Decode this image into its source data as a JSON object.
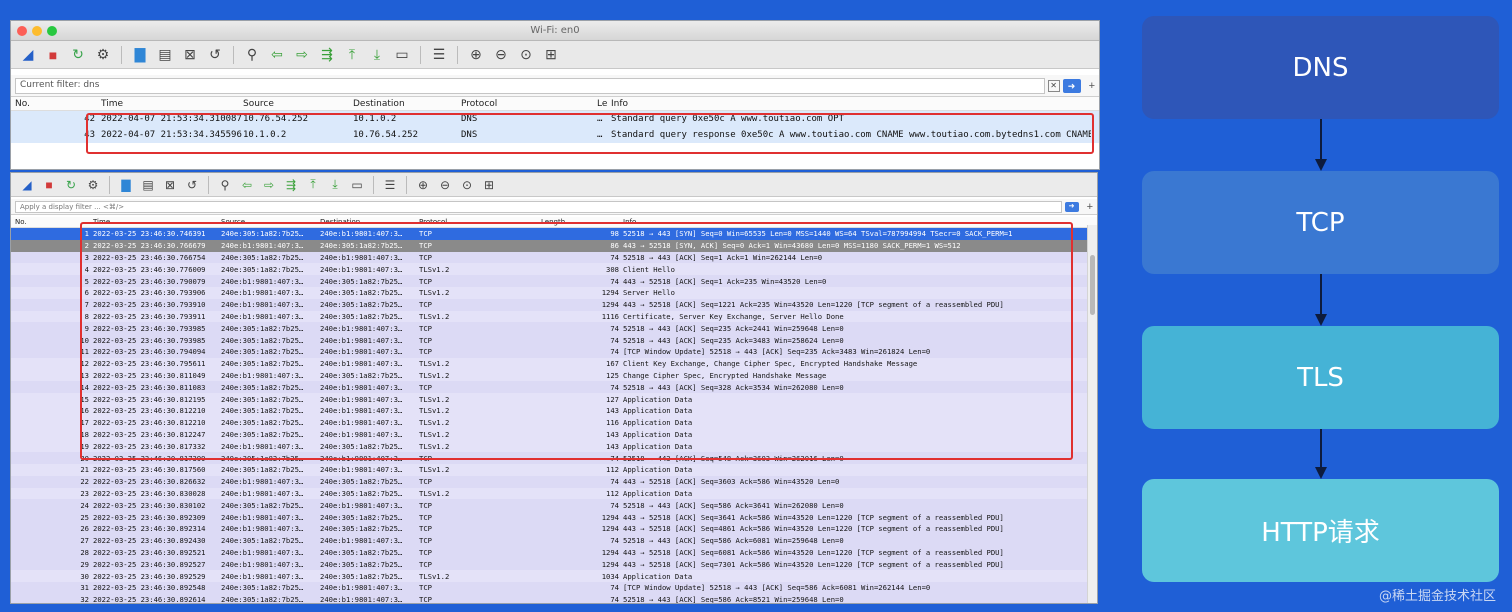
{
  "window1": {
    "title": "Wi-Fi: en0",
    "filter_value": "Current filter: dns",
    "columns": [
      "No.",
      "Time",
      "Source",
      "Destination",
      "Protocol",
      "Le",
      "Info"
    ],
    "rows": [
      {
        "no": "42",
        "time": "2022-04-07 21:53:34.310087",
        "src": "10.76.54.252",
        "dst": "10.1.0.2",
        "proto": "DNS",
        "len": "…",
        "info": "Standard query 0xe50c A www.toutiao.com OPT"
      },
      {
        "no": "43",
        "time": "2022-04-07 21:53:34.345596",
        "src": "10.1.0.2",
        "dst": "10.76.54.252",
        "proto": "DNS",
        "len": "…",
        "info": "Standard query response 0xe50c A www.toutiao.com CNAME www.toutiao.com.bytedns1.com CNAME www.t"
      }
    ]
  },
  "window2": {
    "filter_placeholder": "Apply a display filter ... <⌘/>",
    "columns": [
      "No.",
      "Time",
      "Source",
      "Destination",
      "Protocol",
      "Length",
      "Info"
    ],
    "rows": [
      {
        "no": "1",
        "time": "2022-03-25 23:46:30.746391",
        "src": "240e:305:1a82:7b25…",
        "dst": "240e:b1:9801:407:3…",
        "proto": "TCP",
        "len": "98",
        "info": "52518 → 443 [SYN] Seq=0 Win=65535 Len=0 MSS=1440 WS=64 TSval=787994994 TSecr=0 SACK_PERM=1",
        "style": "sel"
      },
      {
        "no": "2",
        "time": "2022-03-25 23:46:30.766679",
        "src": "240e:b1:9801:407:3…",
        "dst": "240e:305:1a82:7b25…",
        "proto": "TCP",
        "len": "86",
        "info": "443 → 52518 [SYN, ACK] Seq=0 Ack=1 Win=43680 Len=0 MSS=1180 SACK_PERM=1 WS=512",
        "style": "dark"
      },
      {
        "no": "3",
        "time": "2022-03-25 23:46:30.766754",
        "src": "240e:305:1a82:7b25…",
        "dst": "240e:b1:9801:407:3…",
        "proto": "TCP",
        "len": "74",
        "info": "52518 → 443 [ACK] Seq=1 Ack=1 Win=262144 Len=0",
        "style": ""
      },
      {
        "no": "4",
        "time": "2022-03-25 23:46:30.776009",
        "src": "240e:305:1a82:7b25…",
        "dst": "240e:b1:9801:407:3…",
        "proto": "TLSv1.2",
        "len": "308",
        "info": "Client Hello",
        "style": "tls"
      },
      {
        "no": "5",
        "time": "2022-03-25 23:46:30.790079",
        "src": "240e:b1:9801:407:3…",
        "dst": "240e:305:1a82:7b25…",
        "proto": "TCP",
        "len": "74",
        "info": "443 → 52518 [ACK] Seq=1 Ack=235 Win=43520 Len=0",
        "style": ""
      },
      {
        "no": "6",
        "time": "2022-03-25 23:46:30.793906",
        "src": "240e:b1:9801:407:3…",
        "dst": "240e:305:1a82:7b25…",
        "proto": "TLSv1.2",
        "len": "1294",
        "info": "Server Hello",
        "style": "tls"
      },
      {
        "no": "7",
        "time": "2022-03-25 23:46:30.793910",
        "src": "240e:b1:9801:407:3…",
        "dst": "240e:305:1a82:7b25…",
        "proto": "TCP",
        "len": "1294",
        "info": "443 → 52518 [ACK] Seq=1221 Ack=235 Win=43520 Len=1220 [TCP segment of a reassembled PDU]",
        "style": ""
      },
      {
        "no": "8",
        "time": "2022-03-25 23:46:30.793911",
        "src": "240e:b1:9801:407:3…",
        "dst": "240e:305:1a82:7b25…",
        "proto": "TLSv1.2",
        "len": "1116",
        "info": "Certificate, Server Key Exchange, Server Hello Done",
        "style": "tls"
      },
      {
        "no": "9",
        "time": "2022-03-25 23:46:30.793985",
        "src": "240e:305:1a82:7b25…",
        "dst": "240e:b1:9801:407:3…",
        "proto": "TCP",
        "len": "74",
        "info": "52518 → 443 [ACK] Seq=235 Ack=2441 Win=259648 Len=0",
        "style": ""
      },
      {
        "no": "10",
        "time": "2022-03-25 23:46:30.793985",
        "src": "240e:305:1a82:7b25…",
        "dst": "240e:b1:9801:407:3…",
        "proto": "TCP",
        "len": "74",
        "info": "52518 → 443 [ACK] Seq=235 Ack=3483 Win=258624 Len=0",
        "style": ""
      },
      {
        "no": "11",
        "time": "2022-03-25 23:46:30.794094",
        "src": "240e:305:1a82:7b25…",
        "dst": "240e:b1:9801:407:3…",
        "proto": "TCP",
        "len": "74",
        "info": "[TCP Window Update] 52518 → 443 [ACK] Seq=235 Ack=3483 Win=261824 Len=0",
        "style": ""
      },
      {
        "no": "12",
        "time": "2022-03-25 23:46:30.795611",
        "src": "240e:305:1a82:7b25…",
        "dst": "240e:b1:9801:407:3…",
        "proto": "TLSv1.2",
        "len": "167",
        "info": "Client Key Exchange, Change Cipher Spec, Encrypted Handshake Message",
        "style": "tls"
      },
      {
        "no": "13",
        "time": "2022-03-25 23:46:30.811049",
        "src": "240e:b1:9801:407:3…",
        "dst": "240e:305:1a82:7b25…",
        "proto": "TLSv1.2",
        "len": "125",
        "info": "Change Cipher Spec, Encrypted Handshake Message",
        "style": "tls"
      },
      {
        "no": "14",
        "time": "2022-03-25 23:46:30.811083",
        "src": "240e:305:1a82:7b25…",
        "dst": "240e:b1:9801:407:3…",
        "proto": "TCP",
        "len": "74",
        "info": "52518 → 443 [ACK] Seq=328 Ack=3534 Win=262080 Len=0",
        "style": ""
      },
      {
        "no": "15",
        "time": "2022-03-25 23:46:30.812195",
        "src": "240e:305:1a82:7b25…",
        "dst": "240e:b1:9801:407:3…",
        "proto": "TLSv1.2",
        "len": "127",
        "info": "Application Data",
        "style": "tls"
      },
      {
        "no": "16",
        "time": "2022-03-25 23:46:30.812210",
        "src": "240e:305:1a82:7b25…",
        "dst": "240e:b1:9801:407:3…",
        "proto": "TLSv1.2",
        "len": "143",
        "info": "Application Data",
        "style": "tls"
      },
      {
        "no": "17",
        "time": "2022-03-25 23:46:30.812210",
        "src": "240e:305:1a82:7b25…",
        "dst": "240e:b1:9801:407:3…",
        "proto": "TLSv1.2",
        "len": "116",
        "info": "Application Data",
        "style": "tls"
      },
      {
        "no": "18",
        "time": "2022-03-25 23:46:30.812247",
        "src": "240e:305:1a82:7b25…",
        "dst": "240e:b1:9801:407:3…",
        "proto": "TLSv1.2",
        "len": "143",
        "info": "Application Data",
        "style": "tls"
      },
      {
        "no": "19",
        "time": "2022-03-25 23:46:30.817332",
        "src": "240e:b1:9801:407:3…",
        "dst": "240e:305:1a82:7b25…",
        "proto": "TLSv1.2",
        "len": "143",
        "info": "Application Data",
        "style": "tls"
      },
      {
        "no": "20",
        "time": "2022-03-25 23:46:30.817399",
        "src": "240e:305:1a82:7b25…",
        "dst": "240e:b1:9801:407:3…",
        "proto": "TCP",
        "len": "74",
        "info": "52518 → 443 [ACK] Seq=548 Ack=3603 Win=262016 Len=0",
        "style": ""
      },
      {
        "no": "21",
        "time": "2022-03-25 23:46:30.817560",
        "src": "240e:305:1a82:7b25…",
        "dst": "240e:b1:9801:407:3…",
        "proto": "TLSv1.2",
        "len": "112",
        "info": "Application Data",
        "style": "tls"
      },
      {
        "no": "22",
        "time": "2022-03-25 23:46:30.826632",
        "src": "240e:b1:9801:407:3…",
        "dst": "240e:305:1a82:7b25…",
        "proto": "TCP",
        "len": "74",
        "info": "443 → 52518 [ACK] Seq=3603 Ack=586 Win=43520 Len=0",
        "style": ""
      },
      {
        "no": "23",
        "time": "2022-03-25 23:46:30.830028",
        "src": "240e:b1:9801:407:3…",
        "dst": "240e:305:1a82:7b25…",
        "proto": "TLSv1.2",
        "len": "112",
        "info": "Application Data",
        "style": "tls"
      },
      {
        "no": "24",
        "time": "2022-03-25 23:46:30.830102",
        "src": "240e:305:1a82:7b25…",
        "dst": "240e:b1:9801:407:3…",
        "proto": "TCP",
        "len": "74",
        "info": "52518 → 443 [ACK] Seq=586 Ack=3641 Win=262080 Len=0",
        "style": ""
      },
      {
        "no": "25",
        "time": "2022-03-25 23:46:30.892309",
        "src": "240e:b1:9801:407:3…",
        "dst": "240e:305:1a82:7b25…",
        "proto": "TCP",
        "len": "1294",
        "info": "443 → 52518 [ACK] Seq=3641 Ack=586 Win=43520 Len=1220 [TCP segment of a reassembled PDU]",
        "style": ""
      },
      {
        "no": "26",
        "time": "2022-03-25 23:46:30.892314",
        "src": "240e:b1:9801:407:3…",
        "dst": "240e:305:1a82:7b25…",
        "proto": "TCP",
        "len": "1294",
        "info": "443 → 52518 [ACK] Seq=4861 Ack=586 Win=43520 Len=1220 [TCP segment of a reassembled PDU]",
        "style": ""
      },
      {
        "no": "27",
        "time": "2022-03-25 23:46:30.892430",
        "src": "240e:305:1a82:7b25…",
        "dst": "240e:b1:9801:407:3…",
        "proto": "TCP",
        "len": "74",
        "info": "52518 → 443 [ACK] Seq=586 Ack=6081 Win=259648 Len=0",
        "style": ""
      },
      {
        "no": "28",
        "time": "2022-03-25 23:46:30.892521",
        "src": "240e:b1:9801:407:3…",
        "dst": "240e:305:1a82:7b25…",
        "proto": "TCP",
        "len": "1294",
        "info": "443 → 52518 [ACK] Seq=6081 Ack=586 Win=43520 Len=1220 [TCP segment of a reassembled PDU]",
        "style": ""
      },
      {
        "no": "29",
        "time": "2022-03-25 23:46:30.892527",
        "src": "240e:b1:9801:407:3…",
        "dst": "240e:305:1a82:7b25…",
        "proto": "TCP",
        "len": "1294",
        "info": "443 → 52518 [ACK] Seq=7301 Ack=586 Win=43520 Len=1220 [TCP segment of a reassembled PDU]",
        "style": ""
      },
      {
        "no": "30",
        "time": "2022-03-25 23:46:30.892529",
        "src": "240e:b1:9801:407:3…",
        "dst": "240e:305:1a82:7b25…",
        "proto": "TLSv1.2",
        "len": "1034",
        "info": "Application Data",
        "style": "tls"
      },
      {
        "no": "31",
        "time": "2022-03-25 23:46:30.892548",
        "src": "240e:305:1a82:7b25…",
        "dst": "240e:b1:9801:407:3…",
        "proto": "TCP",
        "len": "74",
        "info": "[TCP Window Update] 52518 → 443 [ACK] Seq=586 Ack=6081 Win=262144 Len=0",
        "style": ""
      },
      {
        "no": "32",
        "time": "2022-03-25 23:46:30.892614",
        "src": "240e:305:1a82:7b25…",
        "dst": "240e:b1:9801:407:3…",
        "proto": "TCP",
        "len": "74",
        "info": "52518 → 443 [ACK] Seq=586 Ack=8521 Win=259648 Len=0",
        "style": ""
      }
    ]
  },
  "flow": {
    "steps": [
      {
        "label": "DNS",
        "color": "#2e56b8"
      },
      {
        "label": "TCP",
        "color": "#3a78d2"
      },
      {
        "label": "TLS",
        "color": "#45b3d6"
      },
      {
        "label": "HTTP请求",
        "color": "#5ec6dc"
      }
    ],
    "arrow_color": "#0d1b3d"
  },
  "watermark": "@稀土掘金技术社区",
  "colors": {
    "background": "#1f5fd6",
    "highlight_box": "#e03030",
    "selected_row": "#2f6be0"
  }
}
